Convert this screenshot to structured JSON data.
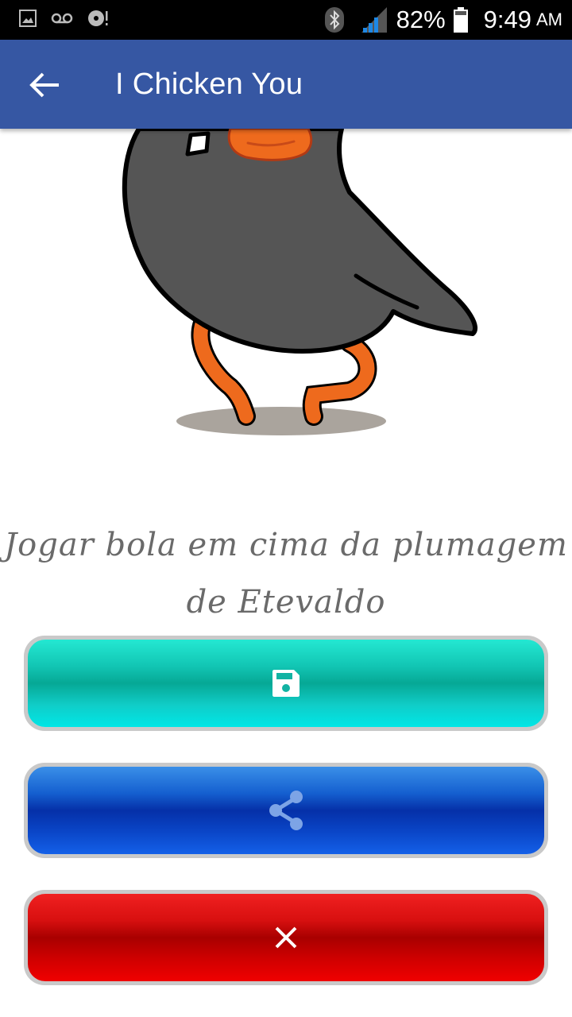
{
  "status_bar": {
    "battery": "82%",
    "time": "9:49",
    "ampm": "AM",
    "icons": [
      "image-icon",
      "voicemail-icon",
      "disc-alert-icon",
      "bluetooth-icon",
      "signal-icon",
      "battery-icon"
    ]
  },
  "app_bar": {
    "title": "I Chicken You",
    "back_icon": "arrow-back-icon"
  },
  "main": {
    "image_subject": "chicken-illustration",
    "caption": "Jogar bola em cima da plumagem de Etevaldo",
    "caption_lines": [
      "Jogar bola em cima da plumagem",
      "de Etevaldo"
    ]
  },
  "buttons": [
    {
      "icon": "save-icon",
      "color": "#12c6b4"
    },
    {
      "icon": "share-icon",
      "color": "#0530a8"
    },
    {
      "icon": "close-icon",
      "color": "#d00000"
    }
  ],
  "colors": {
    "app_bar": "#3657a3",
    "status_bar": "#000000",
    "caption_text": "#6a6a6a"
  }
}
